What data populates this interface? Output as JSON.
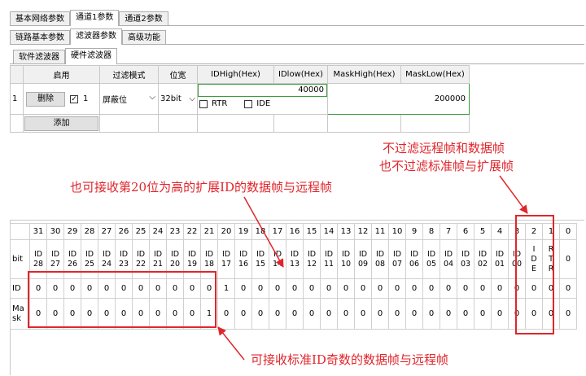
{
  "tabs_top": [
    "基本网络参数",
    "通道1参数",
    "通道2参数"
  ],
  "tabs_mid": [
    "链路基本参数",
    "滤波器参数",
    "高级功能"
  ],
  "tabs_inner": [
    "软件滤波器",
    "硬件滤波器"
  ],
  "filter": {
    "headers": [
      "启用",
      "过滤模式",
      "位宽",
      "IDHigh(Hex)",
      "IDlow(Hex)",
      "MaskHigh(Hex)",
      "MaskLow(Hex)"
    ],
    "row_index": "1",
    "delete_label": "删除",
    "enabled_checked_mark": "✓",
    "enabled_value": "1",
    "mode": "屏蔽位",
    "width": "32bit",
    "id_value": "40000",
    "rtr_label": "RTR",
    "ide_label": "IDE",
    "mask_value": "200000",
    "add_label": "添加"
  },
  "bits": {
    "numbers": [
      "31",
      "30",
      "29",
      "28",
      "27",
      "26",
      "25",
      "24",
      "23",
      "22",
      "21",
      "20",
      "19",
      "18",
      "17",
      "16",
      "15",
      "14",
      "13",
      "12",
      "11",
      "10",
      "9",
      "8",
      "7",
      "6",
      "5",
      "4",
      "3",
      "2",
      "1",
      "0"
    ],
    "bit_label": "bit",
    "names": [
      [
        "ID",
        "28"
      ],
      [
        "ID",
        "27"
      ],
      [
        "ID",
        "26"
      ],
      [
        "ID",
        "25"
      ],
      [
        "ID",
        "24"
      ],
      [
        "ID",
        "23"
      ],
      [
        "ID",
        "22"
      ],
      [
        "ID",
        "21"
      ],
      [
        "ID",
        "20"
      ],
      [
        "ID",
        "19"
      ],
      [
        "ID",
        "18"
      ],
      [
        "ID",
        "17"
      ],
      [
        "ID",
        "16"
      ],
      [
        "ID",
        "15"
      ],
      [
        "ID",
        "14"
      ],
      [
        "ID",
        "13"
      ],
      [
        "ID",
        "12"
      ],
      [
        "ID",
        "11"
      ],
      [
        "ID",
        "10"
      ],
      [
        "ID",
        "09"
      ],
      [
        "ID",
        "08"
      ],
      [
        "ID",
        "07"
      ],
      [
        "ID",
        "06"
      ],
      [
        "ID",
        "05"
      ],
      [
        "ID",
        "04"
      ],
      [
        "ID",
        "03"
      ],
      [
        "ID",
        "02"
      ],
      [
        "ID",
        "01"
      ],
      [
        "ID",
        "00"
      ],
      [
        "I",
        "D",
        "E"
      ],
      [
        "R",
        "T",
        "R"
      ],
      [
        "0"
      ]
    ],
    "id_label": "ID",
    "id_values": [
      "0",
      "0",
      "0",
      "0",
      "0",
      "0",
      "0",
      "0",
      "0",
      "0",
      "0",
      "1",
      "0",
      "0",
      "0",
      "0",
      "0",
      "0",
      "0",
      "0",
      "0",
      "0",
      "0",
      "0",
      "0",
      "0",
      "0",
      "0",
      "0",
      "0",
      "0",
      "0"
    ],
    "mask_label": [
      "Ma",
      "sk"
    ],
    "mask_values": [
      "0",
      "0",
      "0",
      "0",
      "0",
      "0",
      "0",
      "0",
      "0",
      "0",
      "1",
      "0",
      "0",
      "0",
      "0",
      "0",
      "0",
      "0",
      "0",
      "0",
      "0",
      "0",
      "0",
      "0",
      "0",
      "0",
      "0",
      "0",
      "0",
      "0",
      "0",
      "0"
    ]
  },
  "annotations": {
    "top_right_1": "不过滤远程帧和数据帧",
    "top_right_2": "也不过滤标准帧与扩展帧",
    "middle": "也可接收第20位为高的扩展ID的数据帧与远程帧",
    "bottom": "可接收标准ID奇数的数据帧与远程帧"
  }
}
